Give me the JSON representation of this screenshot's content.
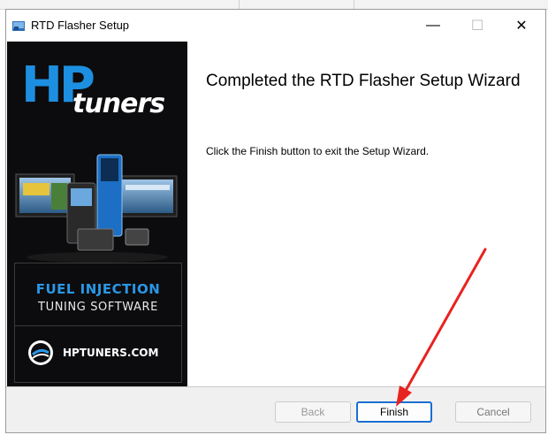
{
  "window": {
    "title": "RTD Flasher Setup",
    "minimize_glyph": "—",
    "maximize_glyph": "☐",
    "close_glyph": "✕"
  },
  "banner": {
    "logo_hp": "HP",
    "logo_tuners": "tuners",
    "tagline_line1": "FUEL INJECTION",
    "tagline_line2": "TUNING SOFTWARE",
    "website": "HPTUNERS.COM",
    "brand_color": "#1d8fe0"
  },
  "content": {
    "heading": "Completed the RTD Flasher Setup Wizard",
    "body": "Click the Finish button to exit the Setup Wizard."
  },
  "footer": {
    "back_label": "Back",
    "finish_label": "Finish",
    "cancel_label": "Cancel"
  },
  "annotation": {
    "arrow_color": "#e8231f"
  }
}
